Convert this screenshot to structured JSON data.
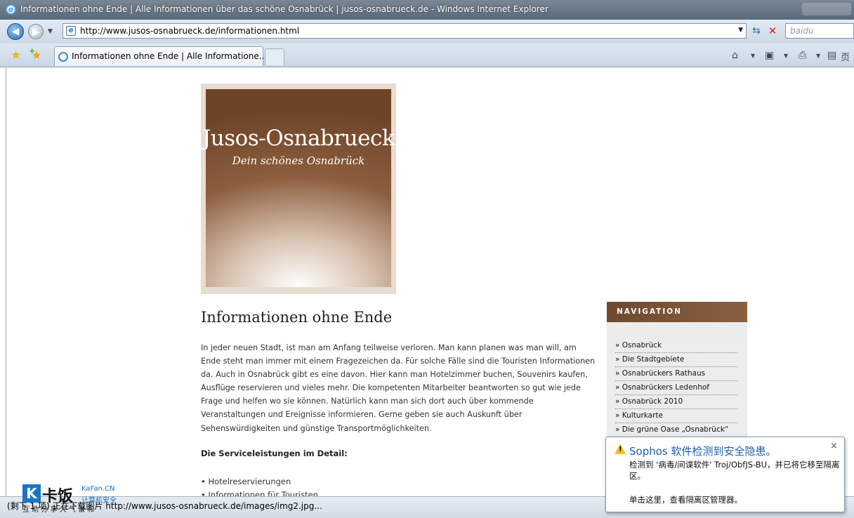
{
  "window": {
    "title": "Informationen ohne Ende | Alle Informationen über das schöne Osnabrück | jusos-osnabrueck.de - Windows Internet Explorer"
  },
  "addressbar": {
    "url": "http://www.jusos-osnabrueck.de/informationen.html",
    "search_placeholder": "baidu"
  },
  "tabs": [
    {
      "label": "Informationen ohne Ende | Alle Informatione..."
    }
  ],
  "toolbar": {
    "page_menu": "页"
  },
  "page": {
    "site_title": "Jusos-Osnabrueck",
    "site_subtitle": "Dein schönes Osnabrück",
    "heading": "Informationen ohne Ende",
    "paragraph": "In jeder neuen Stadt, ist man am Anfang teilweise verloren. Man kann planen was man will, am Ende steht man immer mit einem Fragezeichen da. Für solche Fälle sind die Touristen Informationen da. Auch in Osnabrück gibt es eine davon. Hier kann man Hotelzimmer buchen, Souvenirs kaufen, Ausflüge reservieren und vieles mehr. Die kompetenten Mitarbeiter beantworten so gut wie jede Frage und helfen wo sie können. Natürlich kann man sich dort auch über kommende Veranstaltungen und Ereignisse informieren. Gerne geben sie auch Auskunft über Sehenswürdigkeiten und günstige Transportmöglichkeiten.",
    "subheading": "Die Serviceleistungen im Detail:",
    "services": [
      "• Hotelreservierungen",
      "• Informationen für Touristen"
    ]
  },
  "navigation": {
    "header": "NAVIGATION",
    "items": [
      "» Osnabrück",
      "» Die Stadtgebiete",
      "» Osnabrückers Rathaus",
      "» Osnabrückers Ledenhof",
      "» Osnabrück 2010",
      "» Kulturkarte",
      "» Die grüne Oase „Osnabrück“"
    ]
  },
  "statusbar": {
    "text": "(剩下 1 项) 正在下载图片 http://www.jusos-osnabrueck.de/images/img2.jpg..."
  },
  "watermark": {
    "logo_letter": "K",
    "logo_text": "卡饭",
    "domain": "KaFan.CN",
    "slogan": "计算机安全",
    "tagline": "互 助 分 享   大 气 谦 和"
  },
  "sophos_popup": {
    "title": "Sophos 软件检测到安全隐患。",
    "message": "检测到 '病毒/间谍软件' Troj/ObfJS-BU，并已将它移至隔离区。",
    "link": "单击这里，查看隔离区管理器。",
    "close": "×"
  },
  "colors": {
    "accent_blue": "#1d5fae",
    "nav_header_brown": "#7a5234",
    "warning_yellow": "#f2c020"
  }
}
